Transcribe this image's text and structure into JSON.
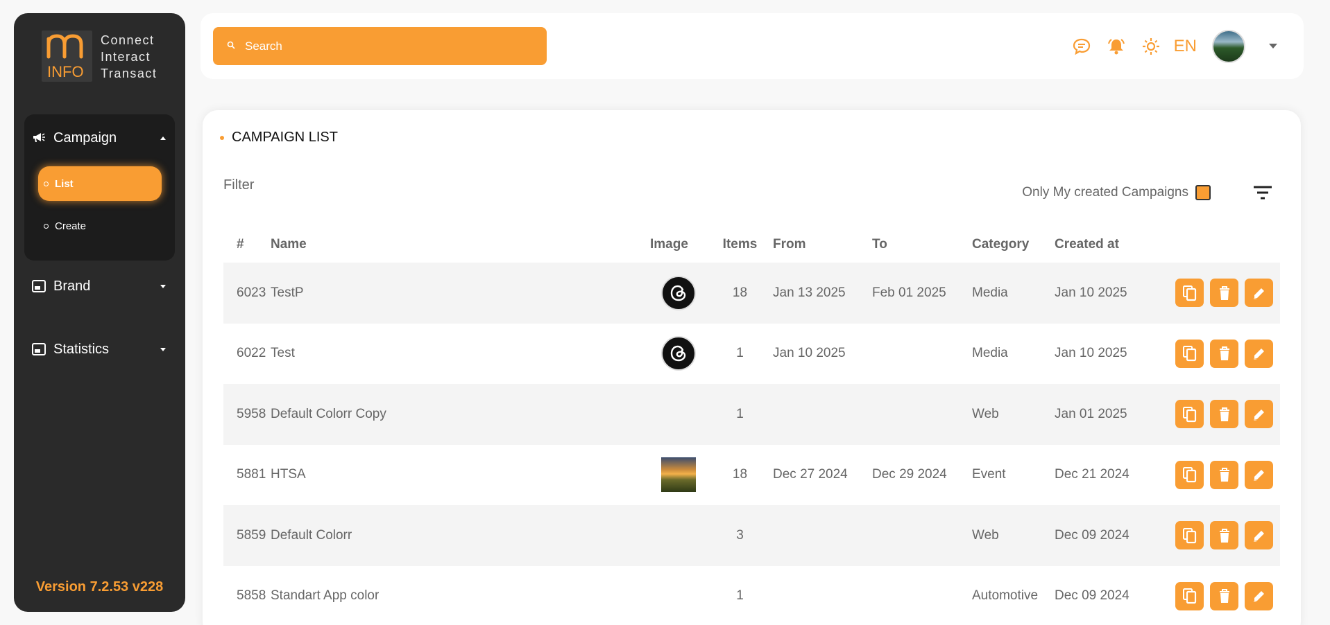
{
  "brand": {
    "logo_text": "INFO",
    "tagline": [
      "Connect",
      "Interact",
      "Transact"
    ]
  },
  "sidebar": {
    "items": [
      {
        "label": "Campaign",
        "icon": "megaphone-icon",
        "expanded": true,
        "children": [
          {
            "label": "List",
            "active": true
          },
          {
            "label": "Create",
            "active": false
          }
        ]
      },
      {
        "label": "Brand",
        "icon": "picture-in-picture-icon",
        "expanded": false
      },
      {
        "label": "Statistics",
        "icon": "picture-in-picture-icon",
        "expanded": false
      }
    ],
    "version": "Version 7.2.53 v228"
  },
  "header": {
    "search_placeholder": "Search",
    "icons": [
      "chat-icon",
      "bell-icon",
      "sun-icon"
    ],
    "language": "EN"
  },
  "main": {
    "title": "CAMPAIGN LIST",
    "filter_label": "Filter",
    "only_mine_label": "Only My created Campaigns",
    "columns": [
      "#",
      "Name",
      "Image",
      "Items",
      "From",
      "To",
      "Category",
      "Created at"
    ],
    "rows": [
      {
        "id": "6023",
        "name": "TestP",
        "image": "threads",
        "items": "18",
        "from": "Jan 13 2025",
        "to": "Feb 01 2025",
        "category": "Media",
        "created": "Jan 10 2025"
      },
      {
        "id": "6022",
        "name": "Test",
        "image": "threads",
        "items": "1",
        "from": "Jan 10 2025",
        "to": "",
        "category": "Media",
        "created": "Jan 10 2025"
      },
      {
        "id": "5958",
        "name": "Default Colorr Copy",
        "image": "",
        "items": "1",
        "from": "",
        "to": "",
        "category": "Web",
        "created": "Jan 01 2025"
      },
      {
        "id": "5881",
        "name": "HTSA",
        "image": "photo",
        "items": "18",
        "from": "Dec 27 2024",
        "to": "Dec 29 2024",
        "category": "Event",
        "created": "Dec 21 2024"
      },
      {
        "id": "5859",
        "name": "Default Colorr",
        "image": "",
        "items": "3",
        "from": "",
        "to": "",
        "category": "Web",
        "created": "Dec 09 2024"
      },
      {
        "id": "5858",
        "name": "Standart App color",
        "image": "",
        "items": "1",
        "from": "",
        "to": "",
        "category": "Automotive",
        "created": "Dec 09 2024"
      }
    ],
    "row_actions": [
      "copy-icon",
      "trash-icon",
      "edit-icon"
    ]
  },
  "colors": {
    "accent": "#f99d33",
    "sidebar_bg": "#2a2a2a",
    "nav_group_bg": "#1c1c1c"
  }
}
